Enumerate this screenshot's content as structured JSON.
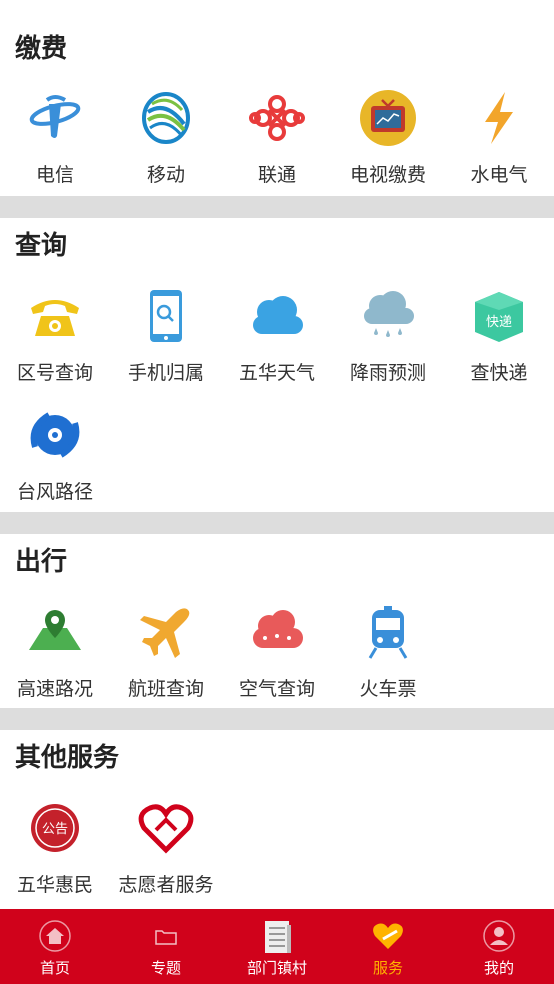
{
  "sections": {
    "payment": {
      "title": "缴费",
      "items": [
        {
          "label": "电信",
          "icon": "telecom-logo-icon"
        },
        {
          "label": "移动",
          "icon": "china-mobile-logo-icon"
        },
        {
          "label": "联通",
          "icon": "china-unicom-logo-icon"
        },
        {
          "label": "电视缴费",
          "icon": "tv-icon"
        },
        {
          "label": "水电气",
          "icon": "lightning-icon"
        }
      ]
    },
    "query": {
      "title": "查询",
      "items": [
        {
          "label": "区号查询",
          "icon": "telephone-icon"
        },
        {
          "label": "手机归属",
          "icon": "phone-search-icon"
        },
        {
          "label": "五华天气",
          "icon": "cloud-icon"
        },
        {
          "label": "降雨预测",
          "icon": "rain-cloud-icon"
        },
        {
          "label": "查快递",
          "icon": "package-icon",
          "badge": "快递"
        },
        {
          "label": "台风路径",
          "icon": "typhoon-icon"
        }
      ]
    },
    "travel": {
      "title": "出行",
      "items": [
        {
          "label": "高速路况",
          "icon": "map-pin-icon"
        },
        {
          "label": "航班查询",
          "icon": "airplane-icon"
        },
        {
          "label": "空气查询",
          "icon": "smog-cloud-icon"
        },
        {
          "label": "火车票",
          "icon": "train-icon"
        }
      ]
    },
    "other": {
      "title": "其他服务",
      "items": [
        {
          "label": "五华惠民",
          "icon": "notice-seal-icon",
          "badge": "公告"
        },
        {
          "label": "志愿者服务",
          "icon": "volunteer-heart-icon"
        }
      ]
    }
  },
  "tabbar": {
    "tabs": [
      {
        "label": "首页",
        "icon": "home-icon"
      },
      {
        "label": "专题",
        "icon": "folder-icon"
      },
      {
        "label": "部门镇村",
        "icon": "document-icon"
      },
      {
        "label": "服务",
        "icon": "heart-service-icon",
        "active": true
      },
      {
        "label": "我的",
        "icon": "user-icon"
      }
    ]
  },
  "colors": {
    "tabbar_bg": "#d0021b",
    "tab_active": "#ffb300",
    "divider": "#dddddd"
  }
}
